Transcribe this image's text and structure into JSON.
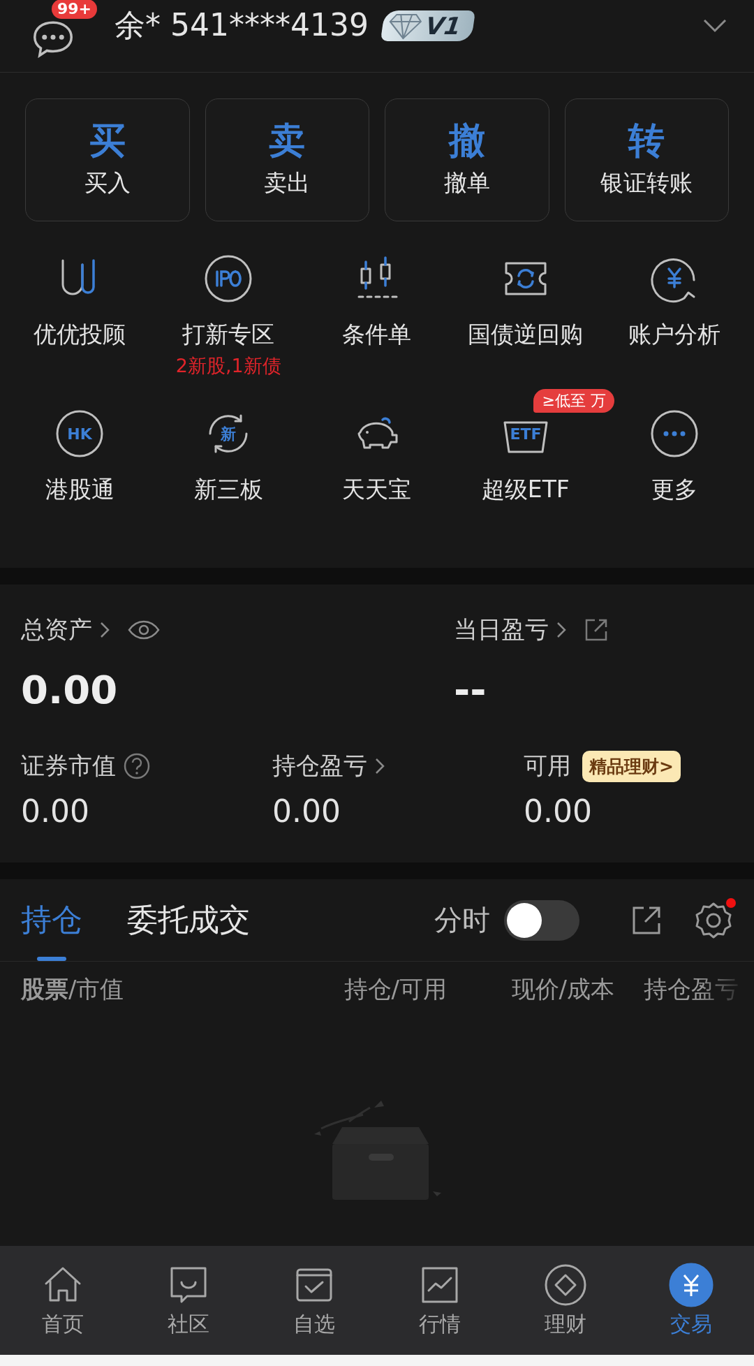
{
  "header": {
    "badge": "99+",
    "account": "余* 541****4139",
    "level": "V1"
  },
  "quick_actions": [
    {
      "glyph": "买",
      "label": "买入"
    },
    {
      "glyph": "卖",
      "label": "卖出"
    },
    {
      "glyph": "撤",
      "label": "撤单"
    },
    {
      "glyph": "转",
      "label": "银证转账"
    }
  ],
  "services": [
    {
      "kind": "uu",
      "label": "优优投顾"
    },
    {
      "kind": "ipo",
      "label": "打新专区",
      "subtitle": "2新股,1新债"
    },
    {
      "kind": "candles",
      "label": "条件单"
    },
    {
      "kind": "repo",
      "label": "国债逆回购"
    },
    {
      "kind": "yen",
      "label": "账户分析"
    },
    {
      "kind": "hk",
      "label": "港股通",
      "icon_text": "HK"
    },
    {
      "kind": "new",
      "label": "新三板",
      "icon_text": "新"
    },
    {
      "kind": "piggy",
      "label": "天天宝"
    },
    {
      "kind": "etf",
      "label": "超级ETF",
      "tag": "≥低至 万",
      "icon_text": "ETF"
    },
    {
      "kind": "more",
      "label": "更多"
    }
  ],
  "assets": {
    "total": {
      "label": "总资产",
      "value": "0.00"
    },
    "daily": {
      "label": "当日盈亏",
      "value": "--"
    },
    "metrics": [
      {
        "kind": "help",
        "label": "证券市值",
        "value": "0.00"
      },
      {
        "kind": "link",
        "label": "持仓盈亏",
        "value": "0.00"
      },
      {
        "kind": "promo",
        "label": "可用",
        "value": "0.00",
        "promo": "精品理财>"
      }
    ]
  },
  "tabs": [
    {
      "label": "持仓",
      "selected": true
    },
    {
      "label": "委托成交",
      "selected": false
    }
  ],
  "timeshare": {
    "label": "分时",
    "on": false
  },
  "settings": {
    "notification": true
  },
  "columns": [
    "**股票**/市值",
    "持仓/可用",
    "现价/成本",
    "持仓盈亏"
  ],
  "nav": [
    {
      "kind": "home",
      "label": "首页",
      "selected": false
    },
    {
      "kind": "community",
      "label": "社区",
      "selected": false
    },
    {
      "kind": "watchlist",
      "label": "自选",
      "selected": false
    },
    {
      "kind": "market",
      "label": "行情",
      "selected": false
    },
    {
      "kind": "wealth",
      "label": "理财",
      "selected": false
    },
    {
      "kind": "trade",
      "label": "交易",
      "selected": true
    }
  ]
}
